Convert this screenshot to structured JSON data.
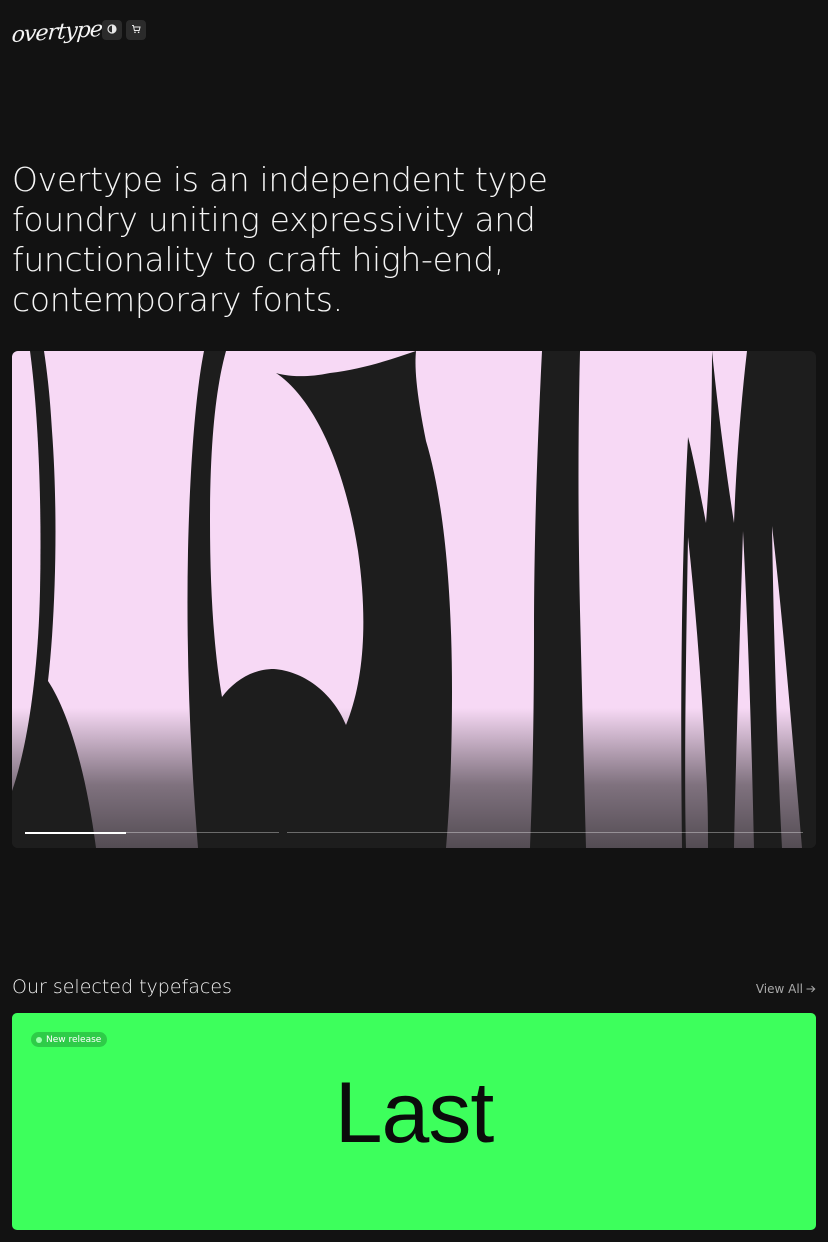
{
  "header": {
    "logo_text": "overtype",
    "theme_icon": "contrast-icon",
    "cart_icon": "cart-icon"
  },
  "intro": {
    "text": "Overtype is an independent type foundry uniting expressivity and functionality to craft high-end, contemporary fonts."
  },
  "hero": {
    "slides": 3,
    "active_slide": 1,
    "active_progress": 0.4,
    "colors": {
      "glyph_background": "#f7d9f5",
      "panel": "#1d1d1d"
    }
  },
  "typefaces": {
    "title": "Our selected typefaces",
    "view_all_label": "View All",
    "view_all_icon": "arrow-right-icon",
    "featured": {
      "badge": "New release",
      "name": "Last",
      "color": "#3dff5c"
    }
  }
}
